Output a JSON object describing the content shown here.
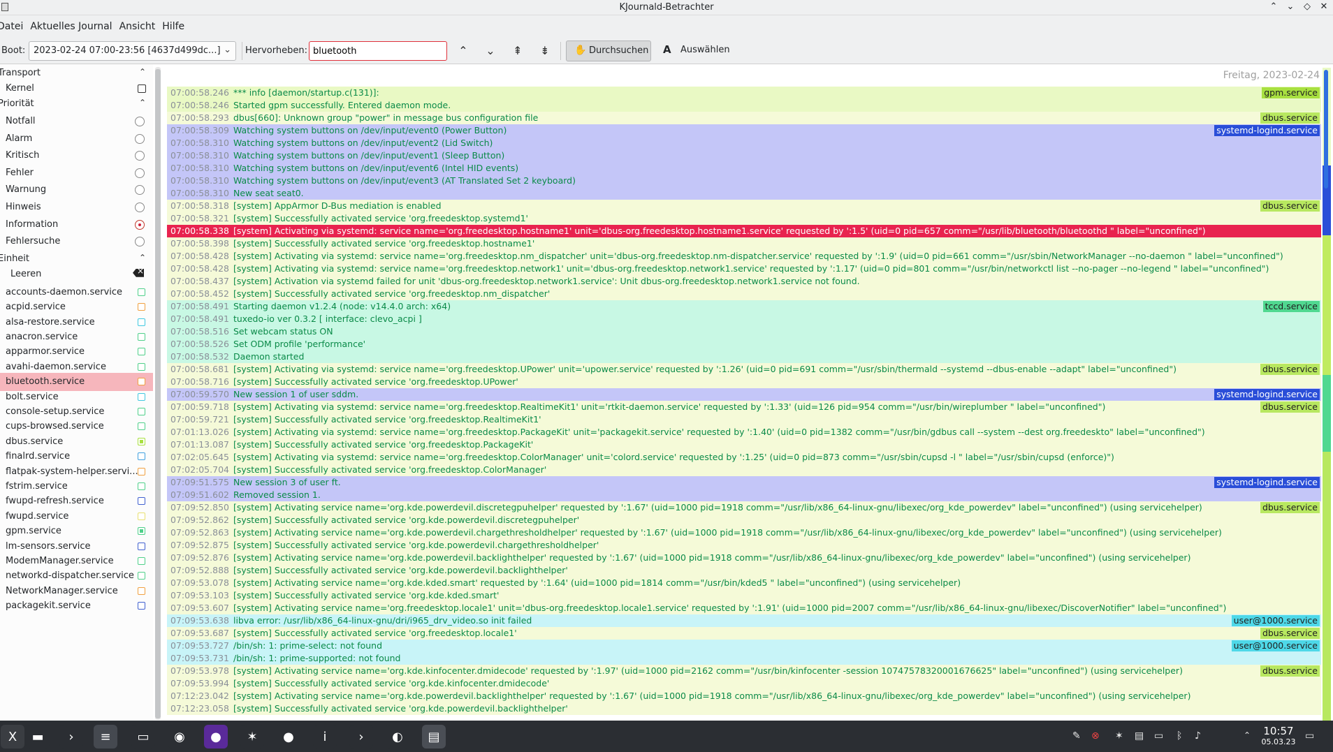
{
  "window": {
    "title": "KJournald-Betrachter"
  },
  "menu": [
    "Datei",
    "Aktuelles Journal",
    "Ansicht",
    "Hilfe"
  ],
  "toolbar": {
    "boot_label": "Boot:",
    "boot_value": "2023-02-24 07:00-23:56 [4637d499dc...]",
    "highlight_label": "Hervorheben:",
    "highlight_value": "bluetooth",
    "browse_label": "Durchsuchen",
    "select_label": "Auswählen"
  },
  "sidebar": {
    "transport_header": "Transport",
    "transport_items": [
      {
        "label": "Kernel"
      }
    ],
    "priority_header": "Priorität",
    "priority_items": [
      {
        "label": "Notfall",
        "selected": false
      },
      {
        "label": "Alarm",
        "selected": false
      },
      {
        "label": "Kritisch",
        "selected": false
      },
      {
        "label": "Fehler",
        "selected": false
      },
      {
        "label": "Warnung",
        "selected": false
      },
      {
        "label": "Hinweis",
        "selected": false
      },
      {
        "label": "Information",
        "selected": true
      },
      {
        "label": "Fehlersuche",
        "selected": false
      }
    ],
    "unit_header": "Einheit",
    "clear_label": "Leeren",
    "services": [
      {
        "label": "accounts-daemon.service",
        "color": "#4fd08a",
        "checked": false
      },
      {
        "label": "acpid.service",
        "color": "#f0a040",
        "checked": false
      },
      {
        "label": "alsa-restore.service",
        "color": "#40c8e0",
        "checked": false
      },
      {
        "label": "anacron.service",
        "color": "#4fd08a",
        "checked": false
      },
      {
        "label": "apparmor.service",
        "color": "#4fd08a",
        "checked": false
      },
      {
        "label": "avahi-daemon.service",
        "color": "#4fd08a",
        "checked": false
      },
      {
        "label": "bluetooth.service",
        "color": "#f0a040",
        "checked": false,
        "selected": true
      },
      {
        "label": "bolt.service",
        "color": "#40c8e0",
        "checked": false
      },
      {
        "label": "console-setup.service",
        "color": "#4fd08a",
        "checked": false
      },
      {
        "label": "cups-browsed.service",
        "color": "#4fd08a",
        "checked": false
      },
      {
        "label": "dbus.service",
        "color": "#a8e040",
        "checked": true
      },
      {
        "label": "finalrd.service",
        "color": "#40a0e0",
        "checked": false
      },
      {
        "label": "flatpak-system-helper.servi...",
        "color": "#f0a040",
        "checked": false
      },
      {
        "label": "fstrim.service",
        "color": "#4fd08a",
        "checked": false
      },
      {
        "label": "fwupd-refresh.service",
        "color": "#4060d0",
        "checked": false
      },
      {
        "label": "fwupd.service",
        "color": "#e8e070",
        "checked": false
      },
      {
        "label": "gpm.service",
        "color": "#4fd08a",
        "checked": true
      },
      {
        "label": "lm-sensors.service",
        "color": "#4060d0",
        "checked": false
      },
      {
        "label": "ModemManager.service",
        "color": "#4fd08a",
        "checked": false
      },
      {
        "label": "networkd-dispatcher.service",
        "color": "#4fd08a",
        "checked": false
      },
      {
        "label": "NetworkManager.service",
        "color": "#f0a040",
        "checked": false
      },
      {
        "label": "packagekit.service",
        "color": "#4060d0",
        "checked": false
      }
    ]
  },
  "log": {
    "date_header": "Freitag, 2023-02-24",
    "lines": [
      {
        "ts": "07:00:58.246",
        "msg": "*** info [daemon/startup.c(131)]:",
        "tag": "gpm.service",
        "bg": "#e9f9c4",
        "tagbg": "#a8e040"
      },
      {
        "ts": "07:00:58.246",
        "msg": "Started gpm successfully. Entered daemon mode.",
        "tag": "",
        "bg": "#e9f9c4",
        "tagbg": ""
      },
      {
        "ts": "07:00:58.293",
        "msg": "dbus[660]: Unknown group \"power\" in message bus configuration file",
        "tag": "dbus.service",
        "bg": "#f5fad8",
        "tagbg": "#b8e860"
      },
      {
        "ts": "07:00:58.309",
        "msg": "Watching system buttons on /dev/input/event0 (Power Button)",
        "tag": "systemd-logind.service",
        "bg": "#c4c6f8",
        "tagbg": "#2a4ed8"
      },
      {
        "ts": "07:00:58.310",
        "msg": "Watching system buttons on /dev/input/event2 (Lid Switch)",
        "tag": "",
        "bg": "#c4c6f8",
        "tagbg": ""
      },
      {
        "ts": "07:00:58.310",
        "msg": "Watching system buttons on /dev/input/event1 (Sleep Button)",
        "tag": "",
        "bg": "#c4c6f8",
        "tagbg": ""
      },
      {
        "ts": "07:00:58.310",
        "msg": "Watching system buttons on /dev/input/event6 (Intel HID events)",
        "tag": "",
        "bg": "#c4c6f8",
        "tagbg": ""
      },
      {
        "ts": "07:00:58.310",
        "msg": "Watching system buttons on /dev/input/event3 (AT Translated Set 2 keyboard)",
        "tag": "",
        "bg": "#c4c6f8",
        "tagbg": ""
      },
      {
        "ts": "07:00:58.310",
        "msg": "New seat seat0.",
        "tag": "",
        "bg": "#c4c6f8",
        "tagbg": ""
      },
      {
        "ts": "07:00:58.318",
        "msg": "[system] AppArmor D-Bus mediation is enabled",
        "tag": "dbus.service",
        "bg": "#f5fad8",
        "tagbg": "#b8e860"
      },
      {
        "ts": "07:00:58.321",
        "msg": "[system] Successfully activated service 'org.freedesktop.systemd1'",
        "tag": "",
        "bg": "#f5fad8",
        "tagbg": ""
      },
      {
        "ts": "07:00:58.338",
        "msg": "[system] Activating via systemd: service name='org.freedesktop.hostname1' unit='dbus-org.freedesktop.hostname1.service' requested by ':1.5' (uid=0 pid=657 comm=\"/usr/lib/bluetooth/bluetoothd \" label=\"unconfined\")",
        "tag": "",
        "bg": "#e8234f",
        "tagbg": "",
        "highlight": true
      },
      {
        "ts": "07:00:58.398",
        "msg": "[system] Successfully activated service 'org.freedesktop.hostname1'",
        "tag": "",
        "bg": "#f5fad8",
        "tagbg": ""
      },
      {
        "ts": "07:00:58.428",
        "msg": "[system] Activating via systemd: service name='org.freedesktop.nm_dispatcher' unit='dbus-org.freedesktop.nm-dispatcher.service' requested by ':1.9' (uid=0 pid=661 comm=\"/usr/sbin/NetworkManager --no-daemon \" label=\"unconfined\")",
        "tag": "",
        "bg": "#f5fad8",
        "tagbg": ""
      },
      {
        "ts": "07:00:58.428",
        "msg": "[system] Activating via systemd: service name='org.freedesktop.network1' unit='dbus-org.freedesktop.network1.service' requested by ':1.17' (uid=0 pid=801 comm=\"/usr/bin/networkctl list --no-pager --no-legend \" label=\"unconfined\")",
        "tag": "",
        "bg": "#f5fad8",
        "tagbg": ""
      },
      {
        "ts": "07:00:58.437",
        "msg": "[system] Activation via systemd failed for unit 'dbus-org.freedesktop.network1.service': Unit dbus-org.freedesktop.network1.service not found.",
        "tag": "",
        "bg": "#f5fad8",
        "tagbg": ""
      },
      {
        "ts": "07:00:58.452",
        "msg": "[system] Successfully activated service 'org.freedesktop.nm_dispatcher'",
        "tag": "",
        "bg": "#f5fad8",
        "tagbg": ""
      },
      {
        "ts": "07:00:58.491",
        "msg": "Starting daemon v1.2.4 (node: v14.4.0 arch: x64)",
        "tag": "tccd.service",
        "bg": "#c8f8e4",
        "tagbg": "#50d890"
      },
      {
        "ts": "07:00:58.491",
        "msg": "tuxedo-io ver 0.3.2 [ interface: clevo_acpi ]",
        "tag": "",
        "bg": "#c8f8e4",
        "tagbg": ""
      },
      {
        "ts": "07:00:58.516",
        "msg": "Set webcam status ON",
        "tag": "",
        "bg": "#c8f8e4",
        "tagbg": ""
      },
      {
        "ts": "07:00:58.526",
        "msg": "Set ODM profile 'performance'",
        "tag": "",
        "bg": "#c8f8e4",
        "tagbg": ""
      },
      {
        "ts": "07:00:58.532",
        "msg": "Daemon started",
        "tag": "",
        "bg": "#c8f8e4",
        "tagbg": ""
      },
      {
        "ts": "07:00:58.681",
        "msg": "[system] Activating via systemd: service name='org.freedesktop.UPower' unit='upower.service' requested by ':1.26' (uid=0 pid=691 comm=\"/usr/sbin/thermald --systemd --dbus-enable --adapt\" label=\"unconfined\")",
        "tag": "dbus.service",
        "bg": "#f5fad8",
        "tagbg": "#b8e860"
      },
      {
        "ts": "07:00:58.716",
        "msg": "[system] Successfully activated service 'org.freedesktop.UPower'",
        "tag": "",
        "bg": "#f5fad8",
        "tagbg": ""
      },
      {
        "ts": "07:00:59.570",
        "msg": "New session 1 of user sddm.",
        "tag": "systemd-logind.service",
        "bg": "#c4c6f8",
        "tagbg": "#2a4ed8"
      },
      {
        "ts": "07:00:59.718",
        "msg": "[system] Activating via systemd: service name='org.freedesktop.RealtimeKit1' unit='rtkit-daemon.service' requested by ':1.33' (uid=126 pid=954 comm=\"/usr/bin/wireplumber \" label=\"unconfined\")",
        "tag": "dbus.service",
        "bg": "#f5fad8",
        "tagbg": "#b8e860"
      },
      {
        "ts": "07:00:59.721",
        "msg": "[system] Successfully activated service 'org.freedesktop.RealtimeKit1'",
        "tag": "",
        "bg": "#f5fad8",
        "tagbg": ""
      },
      {
        "ts": "07:01:13.026",
        "msg": "[system] Activating via systemd: service name='org.freedesktop.PackageKit' unit='packagekit.service' requested by ':1.40' (uid=0 pid=1382 comm=\"/usr/bin/gdbus call --system --dest org.freedeskto\" label=\"unconfined\")",
        "tag": "",
        "bg": "#f5fad8",
        "tagbg": ""
      },
      {
        "ts": "07:01:13.087",
        "msg": "[system] Successfully activated service 'org.freedesktop.PackageKit'",
        "tag": "",
        "bg": "#f5fad8",
        "tagbg": ""
      },
      {
        "ts": "07:02:05.645",
        "msg": "[system] Activating via systemd: service name='org.freedesktop.ColorManager' unit='colord.service' requested by ':1.25' (uid=0 pid=873 comm=\"/usr/sbin/cupsd -l \" label=\"/usr/sbin/cupsd (enforce)\")",
        "tag": "",
        "bg": "#f5fad8",
        "tagbg": ""
      },
      {
        "ts": "07:02:05.704",
        "msg": "[system] Successfully activated service 'org.freedesktop.ColorManager'",
        "tag": "",
        "bg": "#f5fad8",
        "tagbg": ""
      },
      {
        "ts": "07:09:51.575",
        "msg": "New session 3 of user ft.",
        "tag": "systemd-logind.service",
        "bg": "#c4c6f8",
        "tagbg": "#2a4ed8"
      },
      {
        "ts": "07:09:51.602",
        "msg": "Removed session 1.",
        "tag": "",
        "bg": "#c4c6f8",
        "tagbg": ""
      },
      {
        "ts": "07:09:52.850",
        "msg": "[system] Activating service name='org.kde.powerdevil.discretegpuhelper' requested by ':1.67' (uid=1000 pid=1918 comm=\"/usr/lib/x86_64-linux-gnu/libexec/org_kde_powerdev\" label=\"unconfined\") (using servicehelper)",
        "tag": "dbus.service",
        "bg": "#f5fad8",
        "tagbg": "#b8e860"
      },
      {
        "ts": "07:09:52.862",
        "msg": "[system] Successfully activated service 'org.kde.powerdevil.discretegpuhelper'",
        "tag": "",
        "bg": "#f5fad8",
        "tagbg": ""
      },
      {
        "ts": "07:09:52.863",
        "msg": "[system] Activating service name='org.kde.powerdevil.chargethresholdhelper' requested by ':1.67' (uid=1000 pid=1918 comm=\"/usr/lib/x86_64-linux-gnu/libexec/org_kde_powerdev\" label=\"unconfined\") (using servicehelper)",
        "tag": "",
        "bg": "#f5fad8",
        "tagbg": ""
      },
      {
        "ts": "07:09:52.875",
        "msg": "[system] Successfully activated service 'org.kde.powerdevil.chargethresholdhelper'",
        "tag": "",
        "bg": "#f5fad8",
        "tagbg": ""
      },
      {
        "ts": "07:09:52.876",
        "msg": "[system] Activating service name='org.kde.powerdevil.backlighthelper' requested by ':1.67' (uid=1000 pid=1918 comm=\"/usr/lib/x86_64-linux-gnu/libexec/org_kde_powerdev\" label=\"unconfined\") (using servicehelper)",
        "tag": "",
        "bg": "#f5fad8",
        "tagbg": ""
      },
      {
        "ts": "07:09:52.888",
        "msg": "[system] Successfully activated service 'org.kde.powerdevil.backlighthelper'",
        "tag": "",
        "bg": "#f5fad8",
        "tagbg": ""
      },
      {
        "ts": "07:09:53.078",
        "msg": "[system] Activating service name='org.kde.kded.smart' requested by ':1.64' (uid=1000 pid=1814 comm=\"/usr/bin/kded5 \" label=\"unconfined\") (using servicehelper)",
        "tag": "",
        "bg": "#f5fad8",
        "tagbg": ""
      },
      {
        "ts": "07:09:53.103",
        "msg": "[system] Successfully activated service 'org.kde.kded.smart'",
        "tag": "",
        "bg": "#f5fad8",
        "tagbg": ""
      },
      {
        "ts": "07:09:53.607",
        "msg": "[system] Activating service name='org.freedesktop.locale1' unit='dbus-org.freedesktop.locale1.service' requested by ':1.91' (uid=1000 pid=2007 comm=\"/usr/lib/x86_64-linux-gnu/libexec/DiscoverNotifier\" label=\"unconfined\")",
        "tag": "",
        "bg": "#f5fad8",
        "tagbg": ""
      },
      {
        "ts": "07:09:53.638",
        "msg": "libva error: /usr/lib/x86_64-linux-gnu/dri/i965_drv_video.so init failed",
        "tag": "user@1000.service",
        "bg": "#c8f4f8",
        "tagbg": "#4ed8e8"
      },
      {
        "ts": "07:09:53.687",
        "msg": "[system] Successfully activated service 'org.freedesktop.locale1'",
        "tag": "dbus.service",
        "bg": "#f5fad8",
        "tagbg": "#b8e860"
      },
      {
        "ts": "07:09:53.727",
        "msg": "/bin/sh: 1: prime-select: not found",
        "tag": "user@1000.service",
        "bg": "#c8f4f8",
        "tagbg": "#4ed8e8"
      },
      {
        "ts": "07:09:53.731",
        "msg": "/bin/sh: 1: prime-supported: not found",
        "tag": "",
        "bg": "#c8f4f8",
        "tagbg": ""
      },
      {
        "ts": "07:09:53.978",
        "msg": "[system] Activating service name='org.kde.kinfocenter.dmidecode' requested by ':1.97' (uid=1000 pid=2162 comm=\"/usr/bin/kinfocenter -session 10747578320001676625\" label=\"unconfined\") (using servicehelper)",
        "tag": "dbus.service",
        "bg": "#f5fad8",
        "tagbg": "#b8e860"
      },
      {
        "ts": "07:09:53.994",
        "msg": "[system] Successfully activated service 'org.kde.kinfocenter.dmidecode'",
        "tag": "",
        "bg": "#f5fad8",
        "tagbg": ""
      },
      {
        "ts": "07:12:23.042",
        "msg": "[system] Activating service name='org.kde.powerdevil.backlighthelper' requested by ':1.67' (uid=1000 pid=1918 comm=\"/usr/lib/x86_64-linux-gnu/libexec/org_kde_powerdev\" label=\"unconfined\") (using servicehelper)",
        "tag": "",
        "bg": "#f5fad8",
        "tagbg": ""
      },
      {
        "ts": "07:12:23.058",
        "msg": "[system] Successfully activated service 'org.kde.powerdevil.backlighthelper'",
        "tag": "",
        "bg": "#f5fad8",
        "tagbg": ""
      }
    ]
  },
  "taskbar": {
    "apps": [
      {
        "icon": "app-launcher-icon",
        "glyph": "X",
        "bg": "#3a3d42"
      },
      {
        "icon": "file-manager-icon",
        "glyph": "▬",
        "bg": "#2b2e33"
      },
      {
        "icon": "terminal-icon",
        "glyph": "›",
        "bg": "#2b2e33"
      },
      {
        "icon": "system-settings-icon",
        "glyph": "≡",
        "bg": "#454950"
      },
      {
        "icon": "dolphin-icon",
        "glyph": "▭",
        "bg": "#2b2e33"
      },
      {
        "icon": "chrome-icon",
        "glyph": "◉",
        "bg": "#2b2e33"
      },
      {
        "icon": "firefox-dev-icon",
        "glyph": "●",
        "bg": "#5a2a9a"
      },
      {
        "icon": "kde-connect-icon",
        "glyph": "✶",
        "bg": "#2b2e33"
      },
      {
        "icon": "firefox-icon",
        "glyph": "●",
        "bg": "#2b2e33"
      },
      {
        "icon": "info-center-icon",
        "glyph": "i",
        "bg": "#2b2e33"
      },
      {
        "icon": "konsole-icon",
        "glyph": "›",
        "bg": "#2b2e33"
      },
      {
        "icon": "screenshot-icon",
        "glyph": "◐",
        "bg": "#2b2e33"
      },
      {
        "icon": "kjournald-icon",
        "glyph": "▤",
        "bg": "#4a4e55"
      }
    ],
    "time": "10:57",
    "date": "05.03.23"
  }
}
